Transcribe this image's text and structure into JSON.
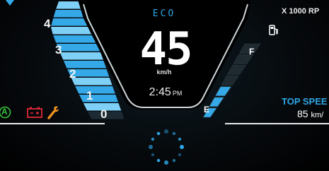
{
  "rpm_gauge": {
    "ticks": [
      "4",
      "3",
      "2",
      "1",
      "0"
    ],
    "unit_label": "X 1000 RP",
    "level": 0.95,
    "colors": {
      "lit": "#35a9e8",
      "lit_light": "#7fd0f7",
      "unlit": "#1c2a33"
    }
  },
  "center": {
    "mode": "ECO",
    "speed": "45",
    "speed_unit": "km/h",
    "time": "2:45",
    "time_ampm": "PM"
  },
  "fuel": {
    "full_label": "F",
    "empty_label": "E",
    "level": 0.4,
    "icon": "fuel-pump-icon"
  },
  "top_speed": {
    "label": "TOP SPEE",
    "value": "85",
    "unit": "km/"
  },
  "indicators": {
    "auto": {
      "label": "A",
      "icon": "auto-hold-icon",
      "color": "#37c43a"
    },
    "battery": {
      "icon": "battery-warning-icon",
      "color": "#e02a36"
    },
    "service": {
      "icon": "wrench-icon",
      "color": "#f1931f"
    }
  },
  "loading": {
    "icon": "loading-spinner-icon",
    "color": "#2ea7e6"
  },
  "colors": {
    "accent": "#2ea7e6",
    "background": "#000000"
  }
}
